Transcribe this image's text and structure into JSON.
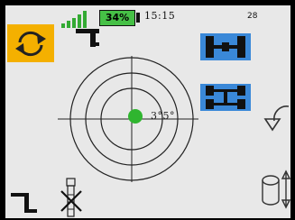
{
  "status": {
    "battery_percent": "34%",
    "time": "15:15",
    "counter": "28",
    "signal_bars": 5
  },
  "level": {
    "readout": "3°5°"
  },
  "colors": {
    "accent": "#f4b000",
    "selected": "#3a88d8",
    "level_dot": "#2fb52f",
    "battery": "#46c046",
    "signal": "#33aa33"
  },
  "icons": {
    "top_left": "rotate-arrows-icon",
    "top_bar": "lift-arm-icon",
    "bottom_left": "lift-arm-icon",
    "bottom_center": "disabled-column-icon",
    "right_upper": "rotate-left-arrow-icon",
    "right_lower": "vertical-spin-icon",
    "axle_top": "axle-icon",
    "axle_bottom": "axle-pair-icon"
  }
}
